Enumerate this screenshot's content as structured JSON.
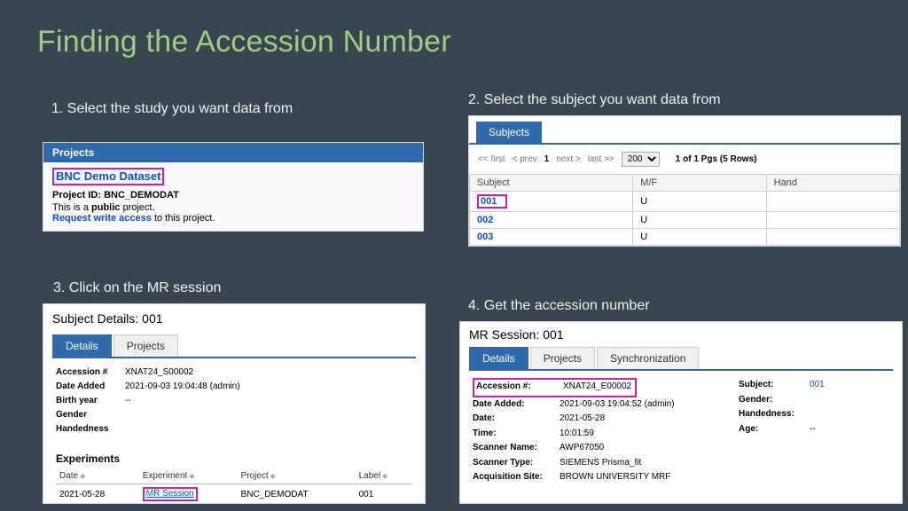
{
  "title": "Finding the Accession Number",
  "steps": {
    "s1": "1. Select the study you want data from",
    "s2": "2. Select the subject you want data from",
    "s3": "3. Click on the MR session",
    "s4": "4. Get the accession number"
  },
  "panel1": {
    "header": "Projects",
    "demo_name": "BNC Demo Dataset",
    "project_id_label": "Project ID: BNC_DEMODAT",
    "desc_pre": "This is a ",
    "desc_bold": "public",
    "desc_post": " project.",
    "request_link": "Request write access",
    "request_post": " to this project."
  },
  "panel2": {
    "tab": "Subjects",
    "nav_first": "<< first",
    "nav_prev": "< prev",
    "nav_cur": "1",
    "nav_next": "next >",
    "nav_last": "last >>",
    "page_size": "200",
    "rows_text": "1 of 1 Pgs (5 Rows)",
    "col_subject": "Subject",
    "col_mf": "M/F",
    "col_hand": "Hand",
    "r1_sub": "001",
    "r1_mf": "U",
    "r2_sub": "002",
    "r2_mf": "U",
    "r3_sub": "003",
    "r3_mf": "U"
  },
  "panel3": {
    "title": "Subject Details: 001",
    "tab_details": "Details",
    "tab_projects": "Projects",
    "k_acc": "Accession #",
    "v_acc": "XNAT24_S00002",
    "k_added": "Date Added",
    "v_added": "2021-09-03 19:04:48 (admin)",
    "k_birth": "Birth year",
    "v_birth": "--",
    "k_gender": "Gender",
    "k_hand": "Handedness",
    "exp_header": "Experiments",
    "col_date": "Date",
    "col_exp": "Experiment",
    "col_proj": "Project",
    "col_label": "Label",
    "row_date": "2021-05-28",
    "row_exp": "MR Session",
    "row_proj": "BNC_DEMODAT",
    "row_label": "001"
  },
  "panel4": {
    "title": "MR Session: 001",
    "tab_details": "Details",
    "tab_projects": "Projects",
    "tab_sync": "Synchronization",
    "k_acc": "Accession #:",
    "v_acc": "XNAT24_E00002",
    "k_added": "Date Added:",
    "v_added": "2021-09-03 19:04:52 (admin)",
    "k_date": "Date:",
    "v_date": "2021-05-28",
    "k_time": "Time:",
    "v_time": "10:01:59",
    "k_scanner": "Scanner Name:",
    "v_scanner": "AWP67050",
    "k_type": "Scanner Type:",
    "v_type": "SIEMENS Prisma_fit",
    "k_site": "Acquisition Site:",
    "v_site": "BROWN UNIVERSITY MRF",
    "k_subject": "Subject:",
    "v_subject": "001",
    "k_gender": "Gender:",
    "k_hand": "Handedness:",
    "k_age": "Age:",
    "v_age": "--"
  }
}
